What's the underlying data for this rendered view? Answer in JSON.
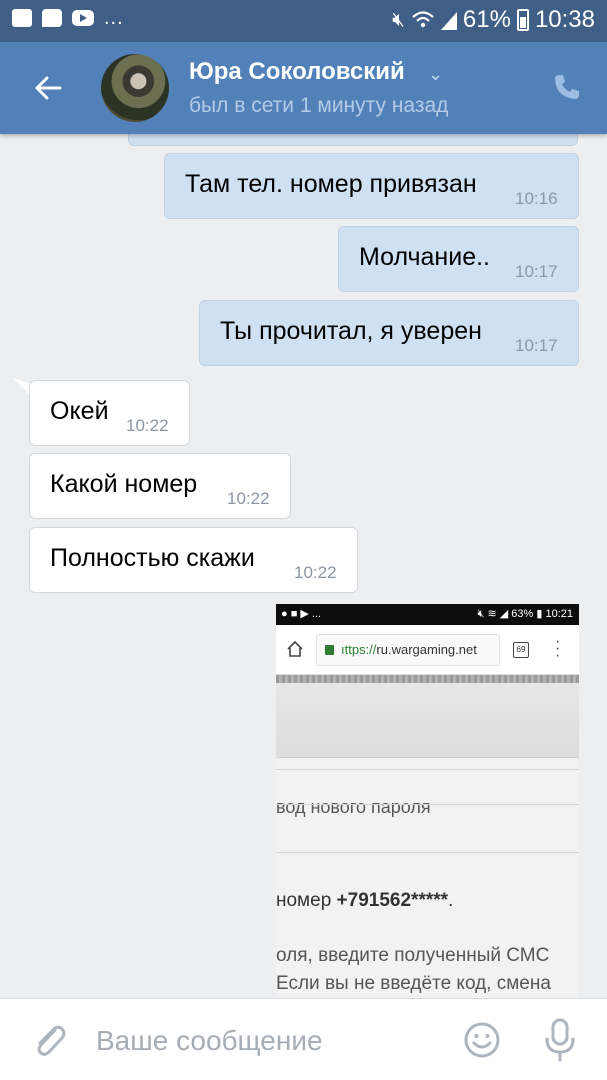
{
  "status_bar": {
    "overflow_dots": "...",
    "battery_percent": "61%",
    "time": "10:38",
    "icons": [
      "image-icon",
      "message-icon",
      "youtube-icon",
      "mute-icon",
      "wifi-icon",
      "signal-icon",
      "battery-icon"
    ]
  },
  "header": {
    "contact_name": "Юра Соколовский",
    "contact_status": "был в сети 1 минуту назад",
    "back_icon": "arrow-left-icon",
    "dropdown_icon": "chevron-down-icon",
    "call_icon": "phone-icon"
  },
  "messages": [
    {
      "direction": "out",
      "text": "Там тел. номер привязан",
      "time": "10:16"
    },
    {
      "direction": "out",
      "text": "Молчание..",
      "time": "10:17"
    },
    {
      "direction": "out",
      "text": "Ты прочитал, я уверен",
      "time": "10:17"
    },
    {
      "direction": "in",
      "text": "Окей",
      "time": "10:22"
    },
    {
      "direction": "in",
      "text": "Какой номер",
      "time": "10:22"
    },
    {
      "direction": "in",
      "text": "Полностью скажи",
      "time": "10:22"
    }
  ],
  "attachment": {
    "status_dots": "...",
    "status_battery": "63%",
    "status_time": "10:21",
    "url_scheme": "ıttps://",
    "url_host": "ru.wargaming.net",
    "tab_count": "69",
    "menu_icon": "more-vertical-icon",
    "heading": "вод нового пароля",
    "phone_prefix": "номер ",
    "phone_value": "+791562*****",
    "phone_suffix": ".",
    "body_line1": "оля, введите полученный СМС",
    "body_line2": "Если вы не введёте код, смена"
  },
  "composer": {
    "placeholder": "Ваше сообщение",
    "attach_icon": "paperclip-icon",
    "emoji_icon": "smile-icon",
    "mic_icon": "microphone-icon"
  },
  "colors": {
    "status_bar": "#3f5f87",
    "header": "#5181b8",
    "background": "#edeef0",
    "outgoing_bubble": "#cfe0f3",
    "incoming_bubble": "#ffffff",
    "url_secure": "#2e7d32"
  }
}
